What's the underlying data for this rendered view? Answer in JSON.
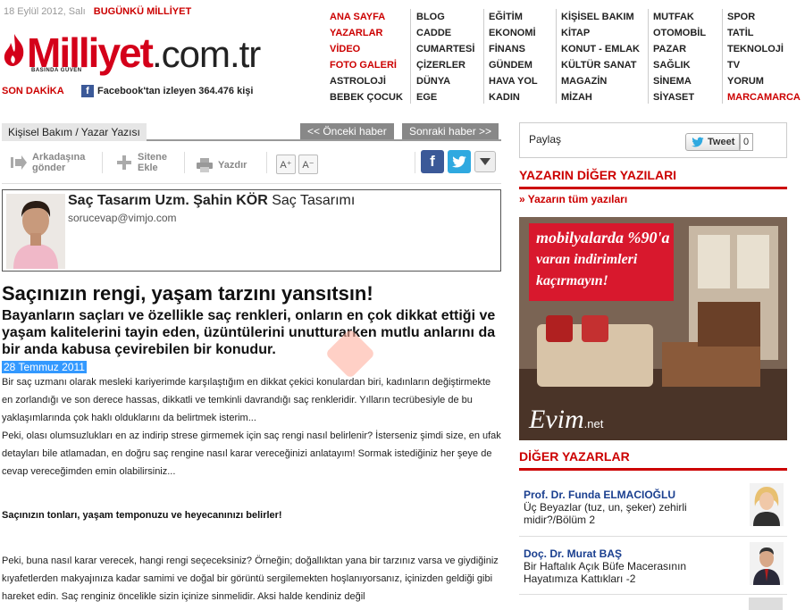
{
  "header": {
    "date": "18 Eylül 2012, Salı",
    "today_link": "BUGÜNKÜ MİLLİYET",
    "logo_word": "Milliyet",
    "logo_tld": ".com.tr",
    "logo_tagline": "BASINDA GÜVEN",
    "son_dakika": "SON DAKİKA",
    "fb_text": "Facebook'tan izleyen 364.476 kişi",
    "fb_letter": "f"
  },
  "nav": {
    "col1": [
      "ANA SAYFA",
      "YAZARLAR",
      "VİDEO",
      "FOTO GALERİ",
      "ASTROLOJİ",
      "BEBEK ÇOCUK"
    ],
    "col2": [
      "BLOG",
      "CADDE",
      "CUMARTESİ",
      "ÇİZERLER",
      "DÜNYA",
      "EGE"
    ],
    "col3": [
      "EĞİTİM",
      "EKONOMİ",
      "FİNANS",
      "GÜNDEM",
      "HAVA YOL",
      "KADIN"
    ],
    "col4": [
      "KİŞİSEL BAKIM",
      "KİTAP",
      "KONUT - EMLAK",
      "KÜLTÜR SANAT",
      "MAGAZİN",
      "MİZAH"
    ],
    "col5": [
      "MUTFAK",
      "OTOMOBİL",
      "PAZAR",
      "SAĞLIK",
      "SİNEMA",
      "SİYASET"
    ],
    "col6": [
      "SPOR",
      "TATİL",
      "TEKNOLOJİ",
      "TV",
      "YORUM",
      "MARCAMARCA"
    ]
  },
  "article_nav": {
    "topic": "Kişisel Bakım / Yazar Yazısı",
    "prev": "<< Önceki haber",
    "next": "Sonraki haber >>"
  },
  "toolbar": {
    "send_line1": "Arkadaşına",
    "send_line2": "gönder",
    "add_line1": "Sitene",
    "add_line2": "Ekle",
    "print": "Yazdır",
    "font_up": "A⁺",
    "font_down": "A⁻"
  },
  "author": {
    "name": "Saç Tasarım Uzm. Şahin KÖR",
    "column": "Saç Tasarımı",
    "email": "sorucevap@vimjo.com"
  },
  "article": {
    "title": "Saçınızın rengi, yaşam tarzını yansıtsın!",
    "lead": "Bayanların saçları ve özellikle saç renkleri, onların en çok dikkat ettiği ve yaşam kalitelerini tayin eden, üzüntülerini unutturarken mutlu anlarını da bir anda kabusa çevirebilen bir konudur.",
    "date": "28 Temmuz 2011",
    "p1": "Bir saç uzmanı olarak mesleki kariyerimde karşılaştığım en dikkat çekici konulardan biri, kadınların değiştirmekte en  zorlandığı ve son derece hassas, dikkatli ve temkinli davrandığı  saç renkleridir. Yılların tecrübesiyle de bu yaklaşımlarında çok haklı olduklarını da belirtmek isterim...",
    "p2": "Peki, olası olumsuzlukları en az indirip strese girmemek için saç rengi nasıl belirlenir? İsterseniz şimdi size, en ufak detayları bile atlamadan, en doğru saç rengine nasıl karar vereceğinizi anlatayım! Sormak istediğiniz her şeye de cevap vereceğimden emin olabilirsiniz...",
    "subhead": "Saçınızın tonları, yaşam temponuzu ve heyecanınızı belirler!",
    "p3": "Peki, buna nasıl karar verecek, hangi rengi seçeceksiniz? Örneğin; doğallıktan yana bir tarzınız varsa ve giydiğiniz kıyafetlerden makyajınıza kadar samimi ve doğal bir görüntü sergilemekten hoşlanıyorsanız, içinizden geldiği gibi hareket edin. Saç renginiz öncelikle sizin içinize sinmelidir. Aksi halde kendiniz değil"
  },
  "sidebar": {
    "share_label": "Paylaş",
    "tweet_label": "Tweet",
    "tweet_count": "0",
    "other_posts_heading": "YAZARIN DİĞER YAZILARI",
    "all_posts_link": "» Yazarın tüm yazıları",
    "ad_line1": "mobilyalarda %90'a",
    "ad_line2": "varan indirimleri",
    "ad_line3": "kaçırmayın!",
    "ad_brand": "Evim",
    "ad_brand_tld": ".net",
    "other_writers_heading": "DİĞER YAZARLAR",
    "writers": [
      {
        "name": "Prof. Dr. Funda ELMACIOĞLU",
        "title": "Üç Beyazlar (tuz, un, şeker) zehirli midir?/Bölüm 2"
      },
      {
        "name": "Doç. Dr. Murat BAŞ",
        "title": "Bir Haftalık Açık Büfe Macerasının Hayatımıza Kattıkları -2"
      }
    ]
  },
  "colors": {
    "brand_red": "#d4001a",
    "link_blue": "#1a3f8f",
    "date_highlight": "#3399ff",
    "facebook": "#3b5998",
    "twitter": "#2fa9e0"
  },
  "icons": {
    "send": "arrow-right-icon",
    "add": "plus-icon",
    "print": "printer-icon",
    "facebook": "facebook-icon",
    "twitter": "twitter-icon",
    "more": "chevron-down-icon"
  }
}
